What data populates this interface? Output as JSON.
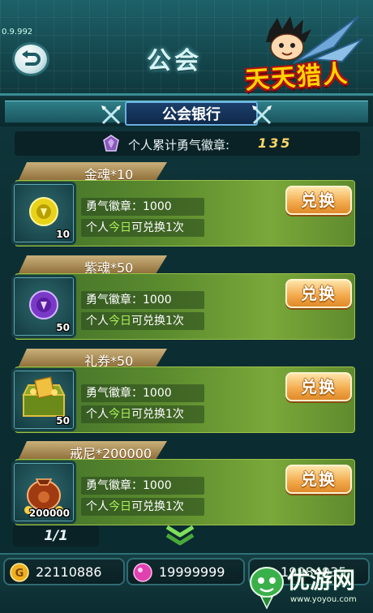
{
  "app": {
    "version": "0.9.992",
    "title": "公会",
    "logo_text": "天天猎人"
  },
  "bank": {
    "title": "公会银行",
    "total_label": "个人累计勇气徽章:",
    "total_value": "135"
  },
  "items": [
    {
      "name": "金魂*10",
      "count": "10",
      "cost_label": "勇气徽章：1000",
      "limit_prefix": "个人",
      "limit_highlight": "今日",
      "limit_suffix": "可兑换1次",
      "button": "兑换",
      "icon": "gold-soul-icon"
    },
    {
      "name": "紫魂*50",
      "count": "50",
      "cost_label": "勇气徽章：1000",
      "limit_prefix": "个人",
      "limit_highlight": "今日",
      "limit_suffix": "可兑换1次",
      "button": "兑换",
      "icon": "purple-soul-icon"
    },
    {
      "name": "礼券*50",
      "count": "50",
      "cost_label": "勇气徽章：1000",
      "limit_prefix": "个人",
      "limit_highlight": "今日",
      "limit_suffix": "可兑换1次",
      "button": "兑换",
      "icon": "voucher-chest-icon"
    },
    {
      "name": "戒尼*200000",
      "count": "200000",
      "cost_label": "勇气徽章：1000",
      "limit_prefix": "个人",
      "limit_highlight": "今日",
      "limit_suffix": "可兑换1次",
      "button": "兑换",
      "icon": "money-bag-icon"
    }
  ],
  "pagination": {
    "label": "1/1"
  },
  "resources": {
    "gold": "22110886",
    "gem": "19999999",
    "third": "19984935"
  },
  "watermark": {
    "text": "优游网",
    "url": "www.yoyou.com"
  },
  "colors": {
    "accent": "#ffd766",
    "card_green": "#5c8c2e",
    "button_orange": "#f2a84a",
    "highlight_green": "#aef05a"
  }
}
